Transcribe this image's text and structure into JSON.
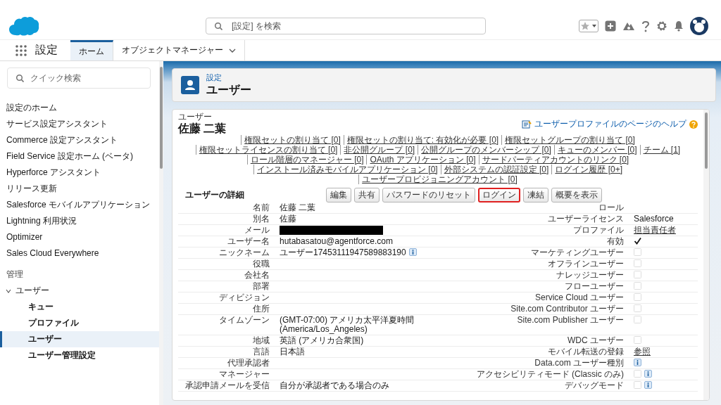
{
  "header": {
    "search": {
      "placeholder": "[設定] を検索"
    }
  },
  "nav": {
    "app_name": "設定",
    "tabs": [
      {
        "label": "ホーム",
        "selected": true,
        "dropdown": false
      },
      {
        "label": "オブジェクトマネージャー",
        "selected": false,
        "dropdown": true
      }
    ]
  },
  "sidebar": {
    "search": {
      "placeholder": "クイック検索"
    },
    "items": [
      {
        "label": "設定のホーム"
      },
      {
        "label": "サービス設定アシスタント"
      },
      {
        "label": "Commerce 設定アシスタント"
      },
      {
        "label": "Field Service 設定ホーム (ベータ)"
      },
      {
        "label": "Hyperforce アシスタント"
      },
      {
        "label": "リリース更新"
      },
      {
        "label": "Salesforce モバイルアプリケーション"
      },
      {
        "label": "Lightning 利用状況"
      },
      {
        "label": "Optimizer"
      },
      {
        "label": "Sales Cloud Everywhere"
      }
    ],
    "section": "管理",
    "tree": [
      {
        "label": "ユーザー",
        "expanded": true,
        "selected": false,
        "children": [
          {
            "label": "キュー",
            "selected": false
          },
          {
            "label": "プロファイル",
            "selected": false
          },
          {
            "label": "ユーザー",
            "selected": true
          },
          {
            "label": "ユーザー管理設定",
            "selected": false
          }
        ]
      }
    ]
  },
  "page_header": {
    "breadcrumb": "設定",
    "title": "ユーザー"
  },
  "detail": {
    "object_label": "ユーザー",
    "name": "佐藤 二葉",
    "help_link": "ユーザープロファイルのページのヘルプ",
    "related_links": [
      "権限セットの割り当て [0]",
      "権限セットの割り当て: 有効化が必要 [0]",
      "権限セットグループの割り当て [0]",
      "権限セットライセンスの割り当て [0]",
      "非公開グループ [0]",
      "公開グループのメンバーシップ [0]",
      "キューのメンバー [0]",
      "チーム [1]",
      "ロール階層のマネージャー [0]",
      "OAuth アプリケーション [0]",
      "サードパーティアカウントのリンク [0]",
      "インストール済みモバイルアプリケーション [0]",
      "外部システムの認証設定 [0]",
      "ログイン履歴 [0+]",
      "ユーザープロビジョニングアカウント [0]"
    ],
    "section_title": "ユーザーの詳細",
    "buttons": [
      {
        "label": "編集",
        "highlighted": false
      },
      {
        "label": "共有",
        "highlighted": false
      },
      {
        "label": "パスワードのリセット",
        "highlighted": false
      },
      {
        "label": "ログイン",
        "highlighted": true
      },
      {
        "label": "凍結",
        "highlighted": false
      },
      {
        "label": "概要を表示",
        "highlighted": false
      }
    ],
    "rows": [
      {
        "left": {
          "label": "名前",
          "kind": "text",
          "value": "佐藤 二葉"
        },
        "right": {
          "label": "ロール",
          "kind": "empty"
        }
      },
      {
        "left": {
          "label": "別名",
          "kind": "text",
          "value": "佐藤"
        },
        "right": {
          "label": "ユーザーライセンス",
          "kind": "text",
          "value": "Salesforce"
        }
      },
      {
        "left": {
          "label": "メール",
          "kind": "redacted"
        },
        "right": {
          "label": "プロファイル",
          "kind": "link",
          "value": "担当責任者"
        }
      },
      {
        "left": {
          "label": "ユーザー名",
          "kind": "text",
          "value": "hutabasatou@agentforce.com"
        },
        "right": {
          "label": "有効",
          "kind": "check",
          "checked": true
        }
      },
      {
        "left": {
          "label": "ニックネーム",
          "kind": "text-info",
          "value": "ユーザー17453111947589883190"
        },
        "right": {
          "label": "マーケティングユーザー",
          "kind": "check",
          "checked": false
        }
      },
      {
        "left": {
          "label": "役職",
          "kind": "empty"
        },
        "right": {
          "label": "オフラインユーザー",
          "kind": "check",
          "checked": false
        }
      },
      {
        "left": {
          "label": "会社名",
          "kind": "empty"
        },
        "right": {
          "label": "ナレッジユーザー",
          "kind": "check",
          "checked": false
        }
      },
      {
        "left": {
          "label": "部署",
          "kind": "empty"
        },
        "right": {
          "label": "フローユーザー",
          "kind": "check",
          "checked": false
        }
      },
      {
        "left": {
          "label": "ディビジョン",
          "kind": "empty"
        },
        "right": {
          "label": "Service Cloud ユーザー",
          "kind": "check",
          "checked": false
        }
      },
      {
        "left": {
          "label": "住所",
          "kind": "empty"
        },
        "right": {
          "label": "Site.com Contributor ユーザー",
          "kind": "check",
          "checked": false
        }
      },
      {
        "left": {
          "label": "タイムゾーン",
          "kind": "text",
          "value": "(GMT-07:00) アメリカ太平洋夏時間 (America/Los_Angeles)"
        },
        "right": {
          "label": "Site.com Publisher ユーザー",
          "kind": "check",
          "checked": false
        }
      },
      {
        "left": {
          "label": "地域",
          "kind": "text",
          "value": "英語 (アメリカ合衆国)"
        },
        "right": {
          "label": "WDC ユーザー",
          "kind": "check",
          "checked": false
        }
      },
      {
        "left": {
          "label": "言語",
          "kind": "text",
          "value": "日本語"
        },
        "right": {
          "label": "モバイル転送の登録",
          "kind": "link",
          "value": "参照"
        }
      },
      {
        "left": {
          "label": "代理承認者",
          "kind": "empty"
        },
        "right": {
          "label": "Data.com ユーザー種別",
          "kind": "info"
        }
      },
      {
        "left": {
          "label": "マネージャー",
          "kind": "empty"
        },
        "right": {
          "label": "アクセシビリティモード (Classic のみ)",
          "kind": "check-info",
          "checked": false
        }
      },
      {
        "left": {
          "label": "承認申請メールを受信",
          "kind": "text",
          "value": "自分が承認者である場合のみ"
        },
        "right": {
          "label": "デバッグモード",
          "kind": "check-info",
          "checked": false
        }
      }
    ]
  }
}
